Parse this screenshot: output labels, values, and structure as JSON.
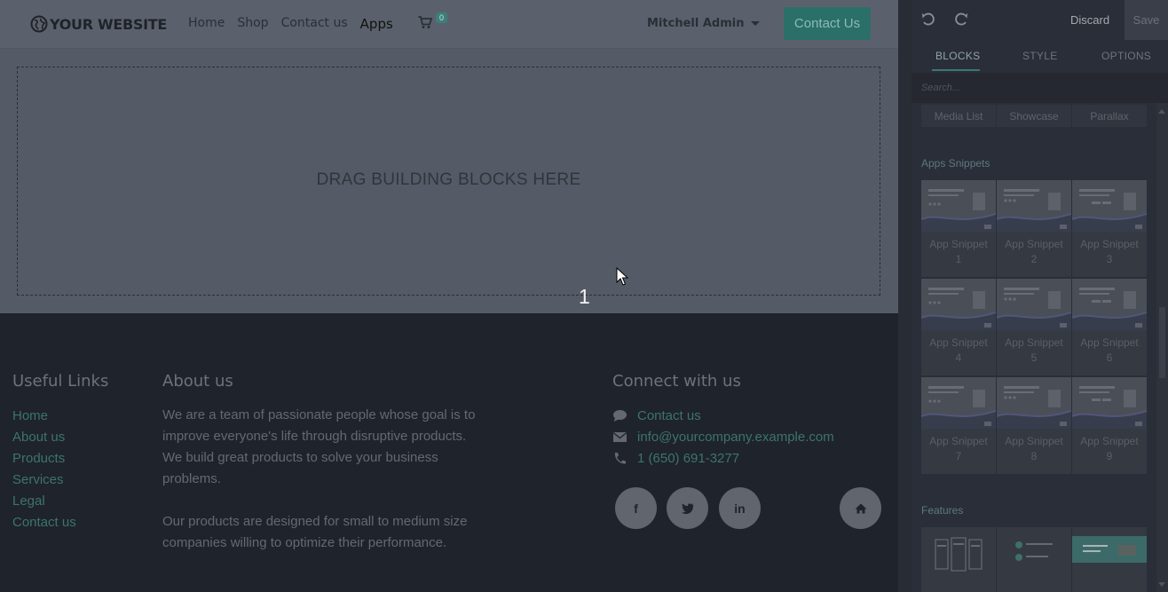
{
  "site": {
    "logo_text": "YOUR WEBSITE",
    "nav": [
      "Home",
      "Shop",
      "Contact us",
      "Apps"
    ],
    "cart_count": "0",
    "user": "Mitchell Admin",
    "cta": "Contact Us",
    "dropzone": "DRAG BUILDING BLOCKS HERE",
    "step_label": "1"
  },
  "footer": {
    "useful_links_title": "Useful Links",
    "useful_links": [
      "Home",
      "About us",
      "Products",
      "Services",
      "Legal",
      "Contact us"
    ],
    "about_title": "About us",
    "about_lines": [
      "We are a team of passionate people whose goal is to",
      "improve everyone's life through disruptive products.",
      "We build great products to solve your business",
      "problems."
    ],
    "about_lines2": [
      "Our products are designed for small to medium size",
      "companies willing to optimize their performance."
    ],
    "connect_title": "Connect with us",
    "contact_link": "Contact us",
    "email": "info@yourcompany.example.com",
    "phone": "1 (650) 691-3277",
    "social_icons": [
      "facebook-icon",
      "twitter-icon",
      "linkedin-icon",
      "home-icon"
    ]
  },
  "panel": {
    "discard": "Discard",
    "save": "Save",
    "tabs": [
      "BLOCKS",
      "STYLE",
      "OPTIONS"
    ],
    "search_placeholder": "Search...",
    "top_row": [
      "Media List",
      "Showcase",
      "Parallax"
    ],
    "apps_title": "Apps Snippets",
    "snippets": [
      {
        "name": "App Snippet",
        "num": "1"
      },
      {
        "name": "App Snippet",
        "num": "2"
      },
      {
        "name": "App Snippet",
        "num": "3"
      },
      {
        "name": "App Snippet",
        "num": "4"
      },
      {
        "name": "App Snippet",
        "num": "5"
      },
      {
        "name": "App Snippet",
        "num": "6"
      },
      {
        "name": "App Snippet",
        "num": "7"
      },
      {
        "name": "App Snippet",
        "num": "8"
      },
      {
        "name": "App Snippet",
        "num": "9"
      }
    ],
    "features_title": "Features"
  },
  "colors": {
    "accent": "#2b6f69",
    "overlay_site": "#555b66",
    "footer_bg": "#1f232b",
    "panel_bg": "#2a2e38"
  }
}
